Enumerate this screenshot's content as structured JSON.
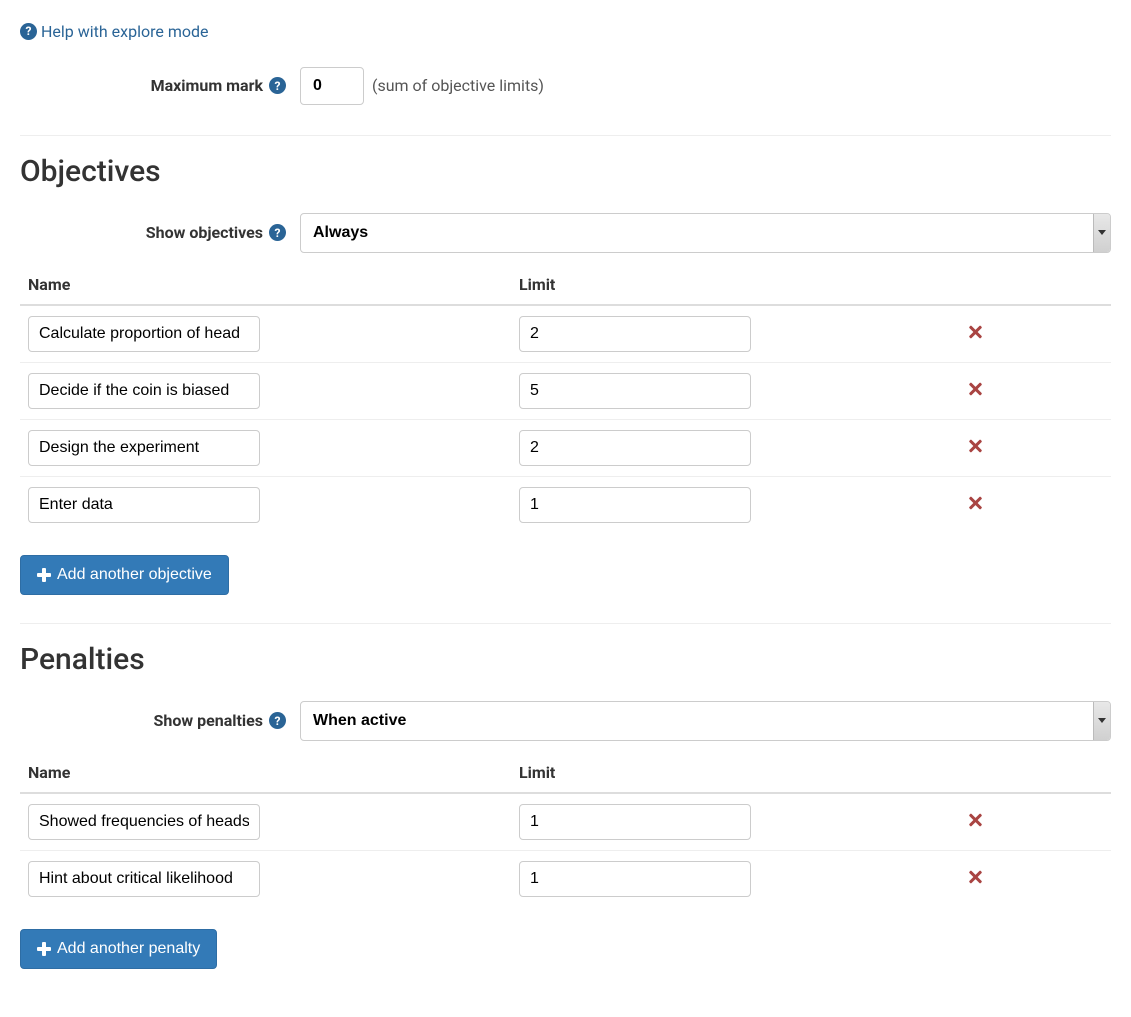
{
  "help": {
    "label": "Help with explore mode"
  },
  "max_mark": {
    "label": "Maximum mark",
    "value": "0",
    "suffix": "(sum of objective limits)"
  },
  "objectives": {
    "heading": "Objectives",
    "show_label": "Show objectives",
    "show_value": "Always",
    "columns": {
      "name": "Name",
      "limit": "Limit"
    },
    "rows": [
      {
        "name": "Calculate proportion of head",
        "limit": "2"
      },
      {
        "name": "Decide if the coin is biased",
        "limit": "5"
      },
      {
        "name": "Design the experiment",
        "limit": "2"
      },
      {
        "name": "Enter data",
        "limit": "1"
      }
    ],
    "add_label": "Add another objective"
  },
  "penalties": {
    "heading": "Penalties",
    "show_label": "Show penalties",
    "show_value": "When active",
    "columns": {
      "name": "Name",
      "limit": "Limit"
    },
    "rows": [
      {
        "name": "Showed frequencies of heads",
        "limit": "1"
      },
      {
        "name": "Hint about critical likelihood",
        "limit": "1"
      }
    ],
    "add_label": "Add another penalty"
  }
}
